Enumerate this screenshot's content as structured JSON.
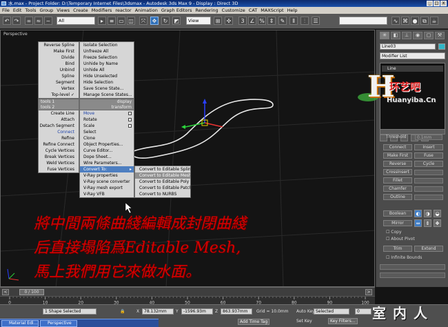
{
  "titlebar": {
    "text": "水.max  - Project Folder: D:\\Temporary Internet Files\\3dsmax      - Autodesk 3ds Max 9      - Display : Direct 3D"
  },
  "menubar": [
    "File",
    "Edit",
    "Tools",
    "Group",
    "Views",
    "Create",
    "Modifiers",
    "reactor",
    "Animation",
    "Graph Editors",
    "Rendering",
    "Customize",
    "CAT",
    "MAXScript",
    "Help"
  ],
  "toolbar": {
    "selection_filter": "All",
    "ref_coord": "View",
    "named_selection": ""
  },
  "viewport": {
    "label": "Perspective"
  },
  "quad_menu": {
    "left_top": [
      "Reverse Spline",
      "Make First",
      "Divide",
      "Bind",
      "Unbind",
      "Spline",
      "Segment",
      "Vertex",
      "Top-level ✓"
    ],
    "right_top": [
      "Isolate Selection",
      "Unfreeze All",
      "Freeze Selection",
      "Unhide by Name",
      "Unhide All",
      "Hide Unselected",
      "Hide Selection",
      "Save Scene State...",
      "Manage Scene States..."
    ],
    "mid_header_left": "tools 1",
    "mid_header_right_left": "tools 2",
    "header_display": "display",
    "header_transform": "transform",
    "left_bottom": [
      "Create Line",
      "Attach",
      "Detach Segment",
      "Connect",
      "Refine",
      "Refine Connect",
      "Cycle Vertices",
      "Break Vertices",
      "Weld Vertices",
      "Fuse Vertices"
    ],
    "right_bottom": [
      "Move",
      "Rotate",
      "Scale",
      "Select",
      "Clone",
      "Object Properties...",
      "Curve Editor...",
      "Dope Sheet...",
      "Wire Parameters...",
      "Convert To:",
      "V-Ray properties",
      "V-Ray scene converter",
      "V-Ray mesh export",
      "V-Ray VFB"
    ],
    "submenu": [
      "Convert to Editable Spline",
      "Convert to Editable Mesh",
      "Convert to Editable Poly",
      "Convert to Editable Patch",
      "Convert to NURBS"
    ]
  },
  "overlay_text": {
    "line1": "將中間兩條曲綫編輯成封閉曲綫",
    "line2": "后直接塌陷爲Editable Mesh,",
    "line3": "馬上我們用它來做水面。"
  },
  "command_panel": {
    "object_name": "Line03",
    "object_color": "#2fb6c7",
    "modifier_list": "Modifier List",
    "stack_item": "Line",
    "threshold_label": "Threshold",
    "threshold_value": "0.1mm",
    "buttons": [
      "Connect",
      "Insert",
      "Make First",
      "Fuse",
      "Reverse",
      "Cycle",
      "CrossInsert",
      "Fillet",
      "Chamfer",
      "Outline",
      "Boolean",
      "Mirror",
      "Trim",
      "Extend"
    ],
    "checkboxes": [
      "Copy",
      "About Pivot",
      "Infinite Bounds"
    ]
  },
  "logo": {
    "big_letter": "H",
    "name": "环艺吧",
    "site": "Huanyiba.Cn"
  },
  "time_slider": {
    "text": "0 / 100"
  },
  "ruler_ticks": [
    "0",
    "10",
    "20",
    "30",
    "40",
    "50",
    "60",
    "70",
    "80",
    "90",
    "100"
  ],
  "status": {
    "selection": "1 Shape Selected",
    "x_label": "X",
    "x_value": "78.132mm",
    "y_label": "Y",
    "y_value": "-1596.93m",
    "z_label": "Z",
    "z_value": "863.937mm",
    "grid": "Grid = 10.0mm",
    "add_time_tag": "Add Time Tag",
    "auto_key": "Auto Key",
    "auto_key_value": "Selected",
    "set_key": "Set Key",
    "key_filters": "Key Filters...",
    "frame_value": "0"
  },
  "taskbar": [
    "Material Edi...",
    "Perspective"
  ],
  "watermark": "室内人"
}
